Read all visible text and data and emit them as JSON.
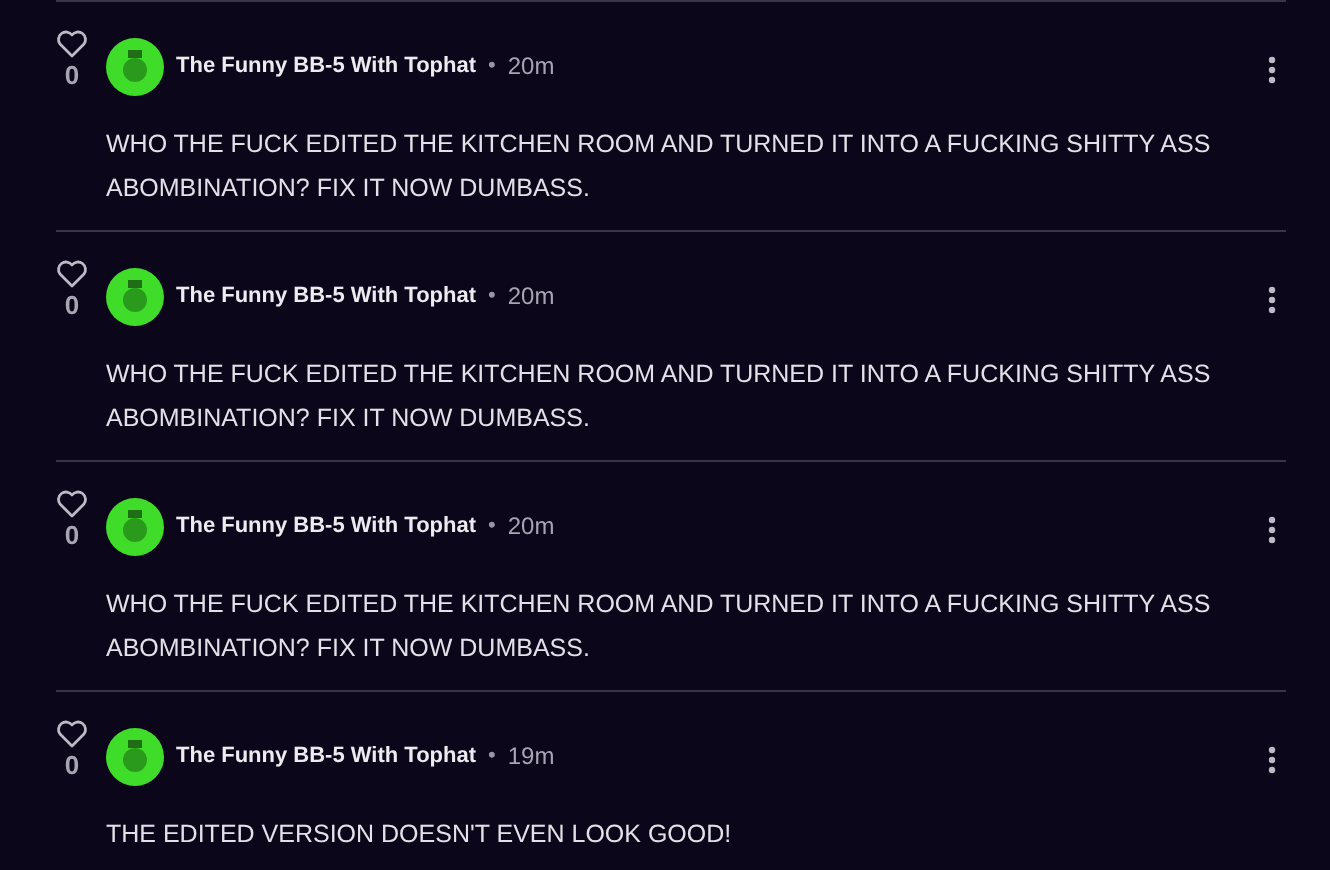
{
  "comments": [
    {
      "likes": "0",
      "author": "The Funny BB-5 With Tophat",
      "separator": "•",
      "time": "20m",
      "text": "WHO THE FUCK EDITED THE KITCHEN ROOM AND TURNED IT INTO A FUCKING SHITTY ASS ABOMBINATION? FIX IT NOW DUMBASS."
    },
    {
      "likes": "0",
      "author": "The Funny BB-5 With Tophat",
      "separator": "•",
      "time": "20m",
      "text": "WHO THE FUCK EDITED THE KITCHEN ROOM AND TURNED IT INTO A FUCKING SHITTY ASS ABOMBINATION? FIX IT NOW DUMBASS."
    },
    {
      "likes": "0",
      "author": "The Funny BB-5 With Tophat",
      "separator": "•",
      "time": "20m",
      "text": "WHO THE FUCK EDITED THE KITCHEN ROOM AND TURNED IT INTO A FUCKING SHITTY ASS ABOMBINATION? FIX IT NOW DUMBASS."
    },
    {
      "likes": "0",
      "author": "The Funny BB-5 With Tophat",
      "separator": "•",
      "time": "19m",
      "text": "THE EDITED VERSION DOESN'T EVEN LOOK GOOD!"
    }
  ]
}
